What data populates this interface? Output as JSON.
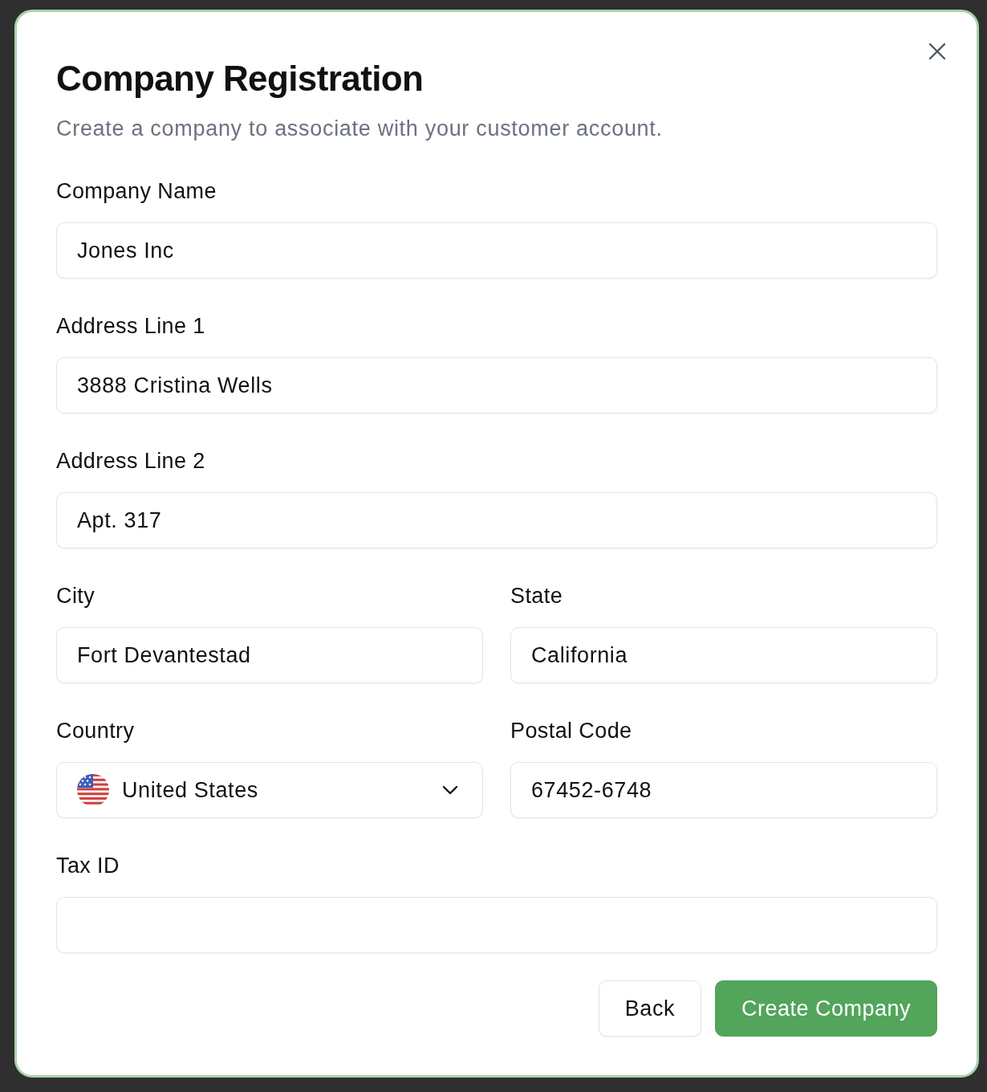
{
  "dialog": {
    "title": "Company Registration",
    "description": "Create a company to associate with your customer account."
  },
  "form": {
    "rows": [
      [
        {
          "label": "Company Name",
          "kind": "text",
          "value": "Jones Inc"
        }
      ],
      [
        {
          "label": "Address Line 1",
          "kind": "text",
          "value": "3888 Cristina Wells"
        }
      ],
      [
        {
          "label": "Address Line 2",
          "kind": "text",
          "value": "Apt. 317"
        }
      ],
      [
        {
          "label": "City",
          "kind": "text",
          "value": "Fort Devantestad"
        },
        {
          "label": "State",
          "kind": "text",
          "value": "California"
        }
      ],
      [
        {
          "label": "Country",
          "kind": "select",
          "value": "United States"
        },
        {
          "label": "Postal Code",
          "kind": "text",
          "value": "67452-6748"
        }
      ],
      [
        {
          "label": "Tax ID",
          "kind": "text"
        }
      ]
    ]
  },
  "buttons": [
    {
      "label": "Back",
      "kind": "secondary"
    },
    {
      "label": "Create Company",
      "kind": "primary"
    }
  ]
}
